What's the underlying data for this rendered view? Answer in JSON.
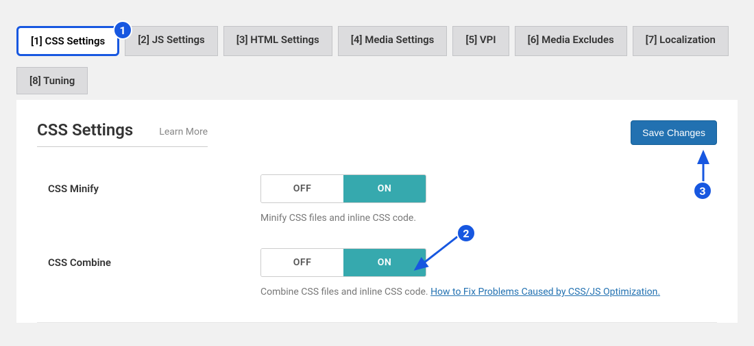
{
  "tabs": {
    "items": [
      {
        "label": "[1] CSS Settings"
      },
      {
        "label": "[2] JS Settings"
      },
      {
        "label": "[3] HTML Settings"
      },
      {
        "label": "[4] Media Settings"
      },
      {
        "label": "[5] VPI"
      },
      {
        "label": "[6] Media Excludes"
      },
      {
        "label": "[7] Localization"
      },
      {
        "label": "[8] Tuning"
      }
    ]
  },
  "heading": {
    "title": "CSS Settings",
    "learn_more": "Learn More"
  },
  "actions": {
    "save": "Save Changes"
  },
  "toggle": {
    "off": "OFF",
    "on": "ON"
  },
  "settings": {
    "css_minify": {
      "label": "CSS Minify",
      "desc": "Minify CSS files and inline CSS code."
    },
    "css_combine": {
      "label": "CSS Combine",
      "desc_prefix": "Combine CSS files and inline CSS code. ",
      "desc_link": "How to Fix Problems Caused by CSS/JS Optimization."
    }
  },
  "annotations": {
    "one": "1",
    "two": "2",
    "three": "3"
  }
}
